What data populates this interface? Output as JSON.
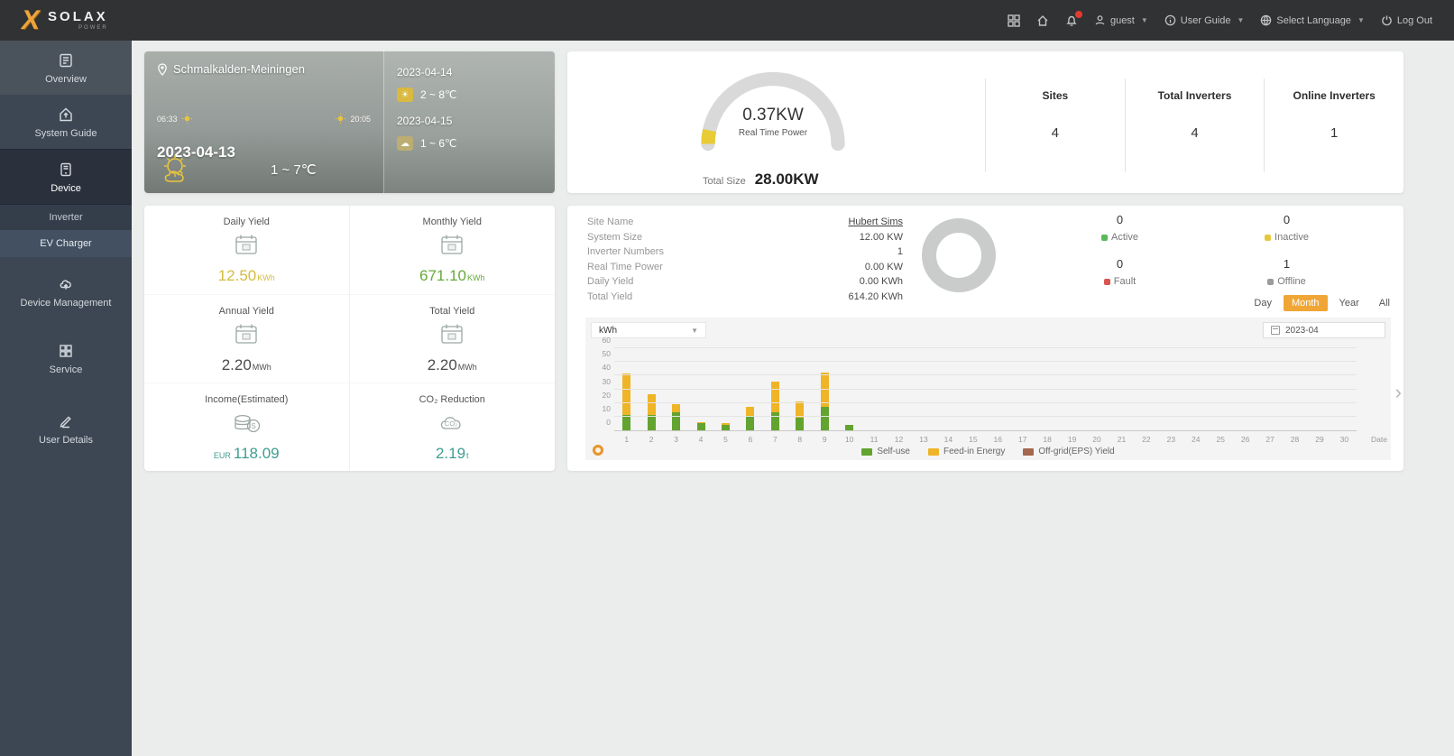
{
  "navbar": {
    "brand": {
      "name": "SOLAX",
      "accent_letter": "X",
      "sub": "POWER"
    },
    "user_label": "guest",
    "user_guide_label": "User Guide",
    "language_label": "Select Language",
    "logout_label": "Log Out"
  },
  "sidebar": {
    "items": [
      {
        "label": "Overview"
      },
      {
        "label": "System Guide"
      },
      {
        "label": "Device"
      },
      {
        "label": "Device Management"
      },
      {
        "label": "Service"
      },
      {
        "label": "User Details"
      }
    ],
    "device_submenu": [
      {
        "label": "Inverter"
      },
      {
        "label": "EV Charger"
      }
    ]
  },
  "weather": {
    "location": "Schmalkalden-Meiningen",
    "sunrise": "06:33",
    "sunset": "20:05",
    "today": {
      "date": "2023-04-13",
      "temp": "1 ~ 7℃"
    },
    "forecast": [
      {
        "date": "2023-04-14",
        "temp": "2 ~ 8℃"
      },
      {
        "date": "2023-04-15",
        "temp": "1 ~ 6℃"
      }
    ]
  },
  "gauge_card": {
    "real_time_power_value": "0.37KW",
    "real_time_power_label": "Real Time Power",
    "total_size_label": "Total Size",
    "total_size_value": "28.00KW",
    "stats": [
      {
        "label": "Sites",
        "value": "4"
      },
      {
        "label": "Total Inverters",
        "value": "4"
      },
      {
        "label": "Online Inverters",
        "value": "1"
      }
    ]
  },
  "yield_card": {
    "tiles": [
      {
        "label": "Daily Yield",
        "prefix": "",
        "value": "12.50",
        "unit": "KWh",
        "color": "#d4bc3e"
      },
      {
        "label": "Monthly Yield",
        "prefix": "",
        "value": "671.10",
        "unit": "KWh",
        "color": "#67a93c"
      },
      {
        "label": "Annual Yield",
        "prefix": "",
        "value": "2.20",
        "unit": "MWh",
        "color": "#4c4c4c"
      },
      {
        "label": "Total Yield",
        "prefix": "",
        "value": "2.20",
        "unit": "MWh",
        "color": "#4c4c4c"
      },
      {
        "label": "Income(Estimated)",
        "prefix": "EUR",
        "value": "118.09",
        "unit": "",
        "color": "#3f9d90"
      },
      {
        "label": "CO₂ Reduction",
        "prefix": "",
        "value": "2.19",
        "unit": "t",
        "color": "#3f9d90"
      }
    ]
  },
  "detail_card": {
    "info": [
      {
        "label": "Site Name",
        "value": "Hubert Sims"
      },
      {
        "label": "System Size",
        "value": "12.00 KW"
      },
      {
        "label": "Inverter Numbers",
        "value": "1"
      },
      {
        "label": "Real Time Power",
        "value": "0.00 KW"
      },
      {
        "label": "Daily Yield",
        "value": "0.00 KWh"
      },
      {
        "label": "Total Yield",
        "value": "614.20 KWh"
      }
    ],
    "status": [
      {
        "label": "Active",
        "value": "0",
        "color": "#5cb85c"
      },
      {
        "label": "Inactive",
        "value": "0",
        "color": "#e6c83c"
      },
      {
        "label": "Fault",
        "value": "0",
        "color": "#d9534f"
      },
      {
        "label": "Offline",
        "value": "1",
        "color": "#9b9b9b"
      }
    ],
    "range_buttons": [
      {
        "label": "Day"
      },
      {
        "label": "Month",
        "selected": true
      },
      {
        "label": "Year"
      },
      {
        "label": "All"
      }
    ],
    "unit_select_value": "kWh",
    "date_value": "2023-04"
  },
  "chart_data": {
    "type": "bar",
    "stacked": true,
    "title": "",
    "xlabel": "Date",
    "ylabel": "kWh",
    "ylim": [
      0,
      60
    ],
    "yticks": [
      0,
      10,
      20,
      30,
      40,
      50,
      60
    ],
    "categories": [
      "1",
      "2",
      "3",
      "4",
      "5",
      "6",
      "7",
      "8",
      "9",
      "10",
      "11",
      "12",
      "13",
      "14",
      "15",
      "16",
      "17",
      "18",
      "19",
      "20",
      "21",
      "22",
      "23",
      "24",
      "25",
      "26",
      "27",
      "28",
      "29",
      "30"
    ],
    "series": [
      {
        "name": "Self-use",
        "color": "#63a32f",
        "values": [
          11,
          11,
          13,
          5,
          4,
          10,
          13,
          9,
          17,
          4,
          0,
          0,
          0,
          0,
          0,
          0,
          0,
          0,
          0,
          0,
          0,
          0,
          0,
          0,
          0,
          0,
          0,
          0,
          0,
          0
        ]
      },
      {
        "name": "Feed-in Energy",
        "color": "#efb427",
        "values": [
          30,
          15,
          6,
          1,
          1,
          7,
          22,
          12,
          25,
          0,
          0,
          0,
          0,
          0,
          0,
          0,
          0,
          0,
          0,
          0,
          0,
          0,
          0,
          0,
          0,
          0,
          0,
          0,
          0,
          0
        ]
      },
      {
        "name": "Off-grid(EPS) Yield",
        "color": "#a5674e",
        "values": [
          0,
          0,
          0,
          0,
          0,
          0,
          0,
          0,
          0,
          0,
          0,
          0,
          0,
          0,
          0,
          0,
          0,
          0,
          0,
          0,
          0,
          0,
          0,
          0,
          0,
          0,
          0,
          0,
          0,
          0
        ]
      }
    ],
    "legend_position": "bottom"
  }
}
